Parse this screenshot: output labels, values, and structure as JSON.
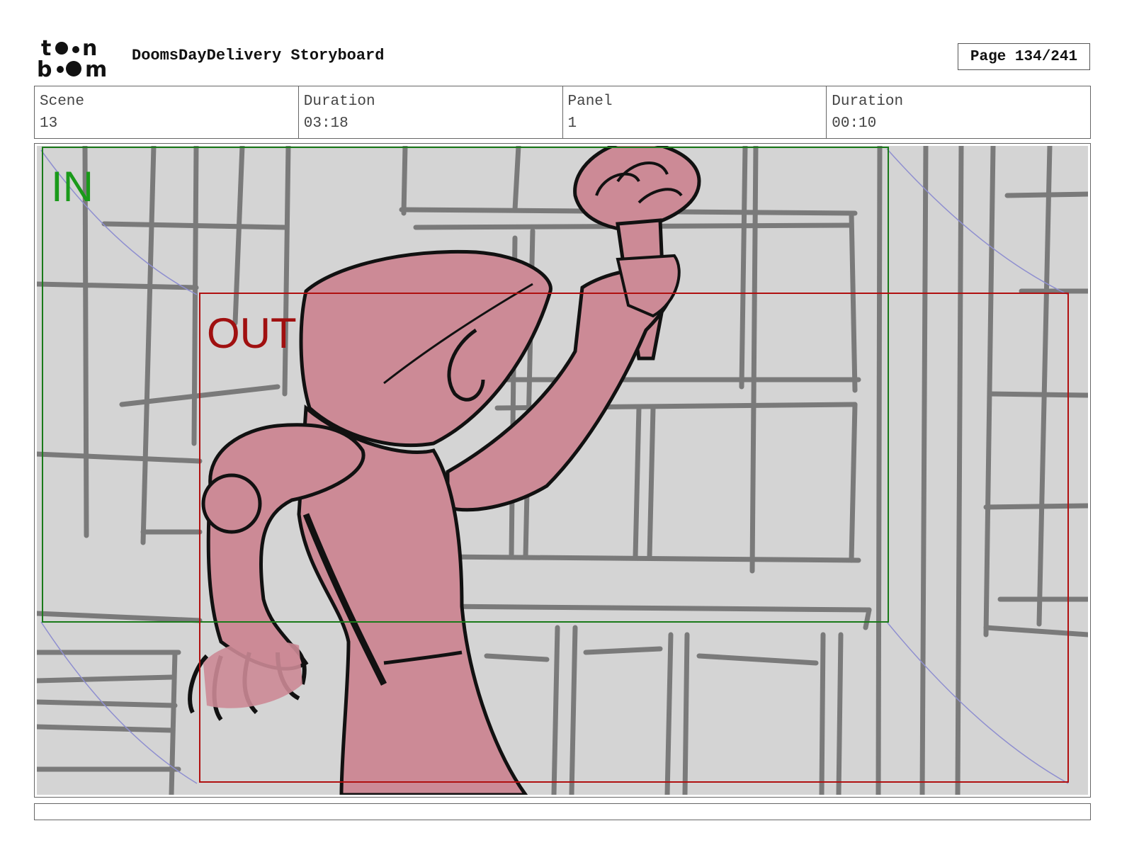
{
  "header": {
    "logo_text": "toon boom",
    "title": "DoomsDayDelivery Storyboard",
    "page": "Page 134/241"
  },
  "info": [
    {
      "label": "Scene",
      "value": "13"
    },
    {
      "label": "Duration",
      "value": "03:18"
    },
    {
      "label": "Panel",
      "value": "1"
    },
    {
      "label": "Duration",
      "value": "00:10"
    }
  ],
  "panel": {
    "in_label": "IN",
    "out_label": "OUT",
    "colors": {
      "background": "#d4d4d4",
      "lines": "#7a7a7a",
      "character_fill": "#cc8a96",
      "ink": "#111111",
      "in_frame": "#1a7a1a",
      "out_frame": "#b01010",
      "motion_path": "#8f8fd0"
    }
  },
  "caption": ""
}
